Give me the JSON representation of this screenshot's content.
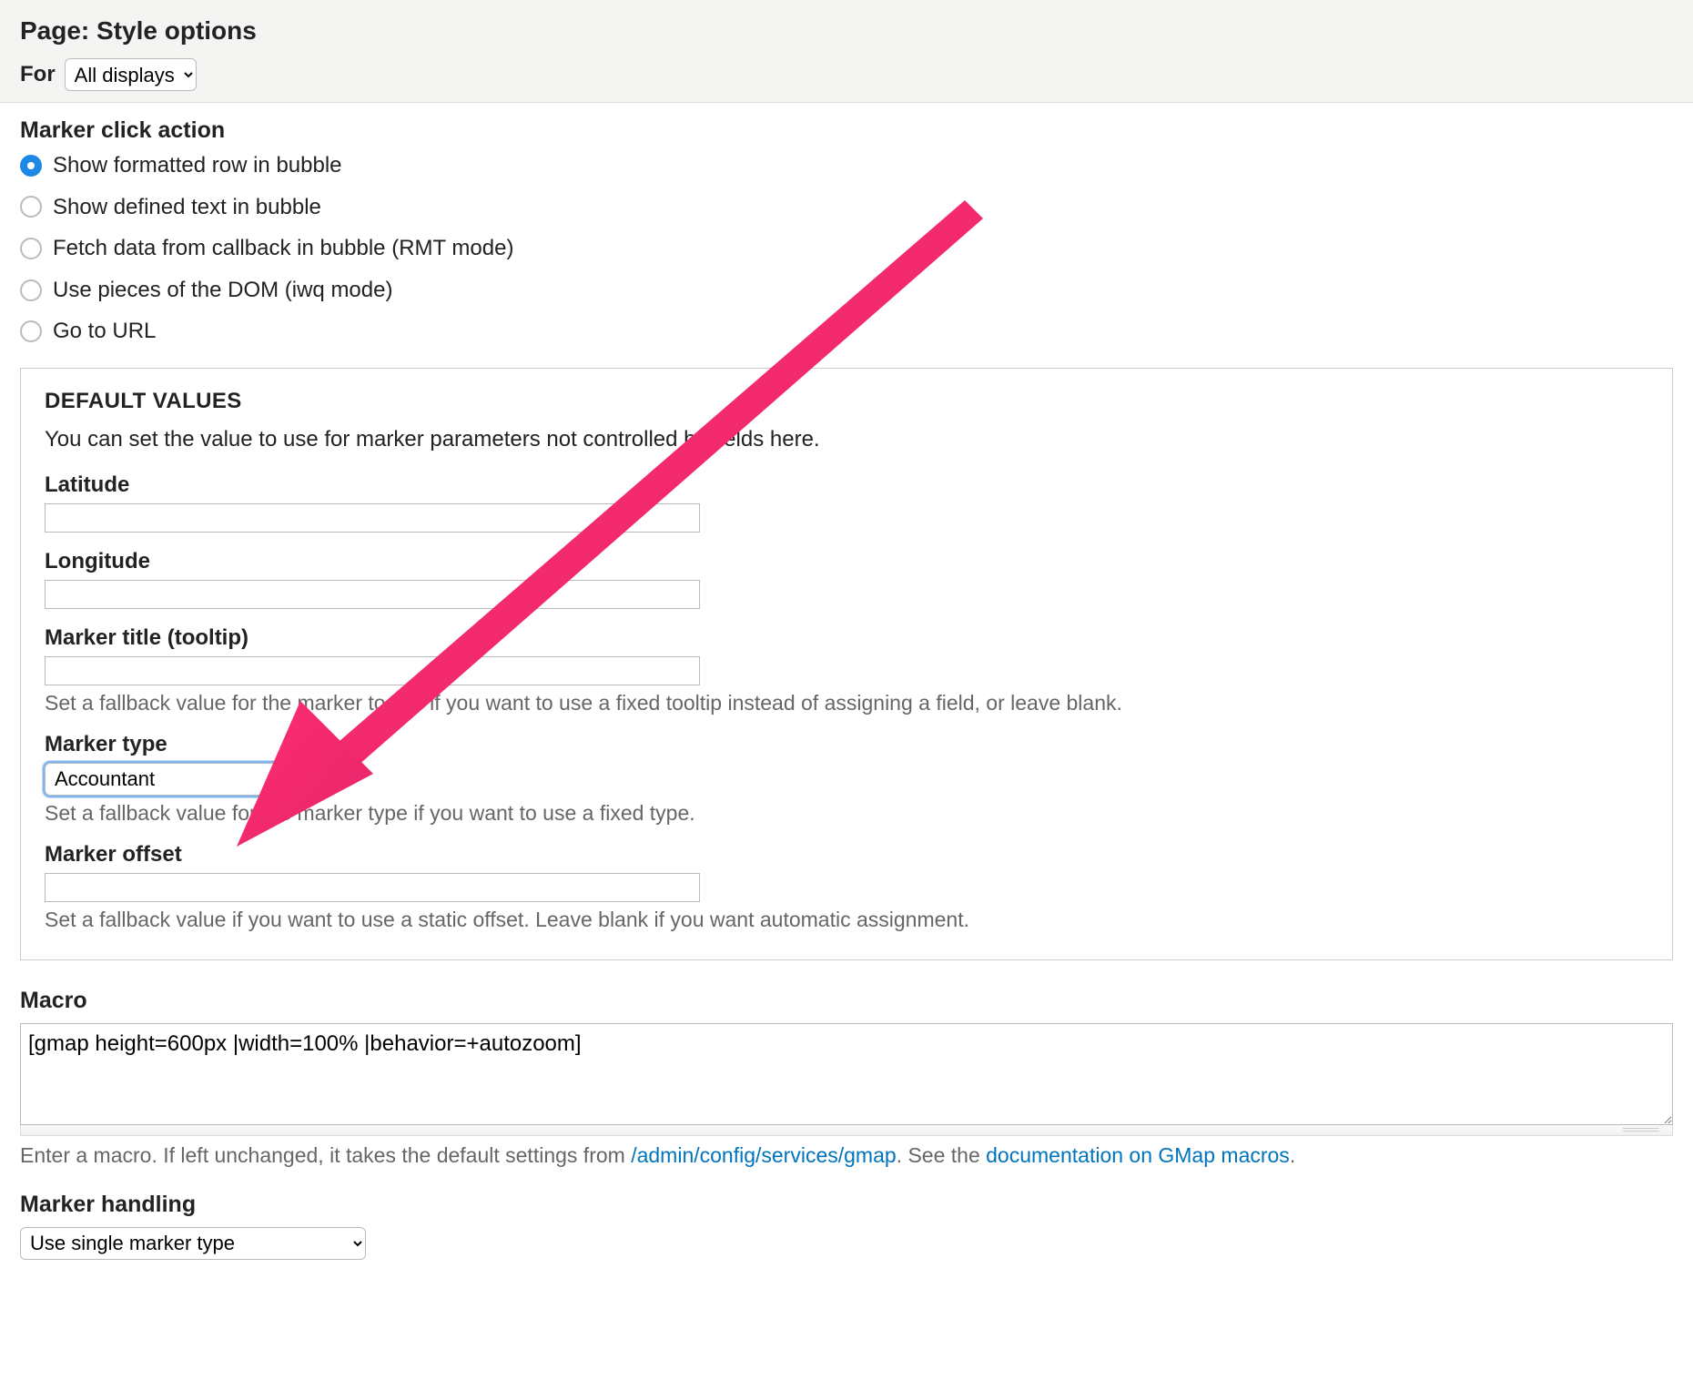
{
  "header": {
    "title": "Page: Style options",
    "for_label": "For",
    "for_value": "All displays"
  },
  "marker_click": {
    "heading": "Marker click action",
    "options": [
      "Show formatted row in bubble",
      "Show defined text in bubble",
      "Fetch data from callback in bubble (RMT mode)",
      "Use pieces of the DOM (iwq mode)",
      "Go to URL"
    ],
    "selected_index": 0
  },
  "defaults": {
    "legend": "DEFAULT VALUES",
    "intro": "You can set the value to use for marker parameters not controlled by fields here.",
    "lat_label": "Latitude",
    "lat_value": "",
    "lon_label": "Longitude",
    "lon_value": "",
    "title_label": "Marker title (tooltip)",
    "title_value": "",
    "title_help": "Set a fallback value for the marker tooltip if you want to use a fixed tooltip instead of assigning a field, or leave blank.",
    "type_label": "Marker type",
    "type_value": "Accountant",
    "type_help": "Set a fallback value for the marker type if you want to use a fixed type.",
    "offset_label": "Marker offset",
    "offset_value": "",
    "offset_help": "Set a fallback value if you want to use a static offset. Leave blank if you want automatic assignment."
  },
  "macro": {
    "label": "Macro",
    "value": "[gmap height=600px |width=100% |behavior=+autozoom]",
    "help_pre": "Enter a macro. If left unchanged, it takes the default settings from ",
    "help_link1": "/admin/config/services/gmap",
    "help_mid": ". See the ",
    "help_link2": "documentation on GMap macros",
    "help_post": "."
  },
  "marker_handling": {
    "label": "Marker handling",
    "value": "Use single marker type"
  }
}
